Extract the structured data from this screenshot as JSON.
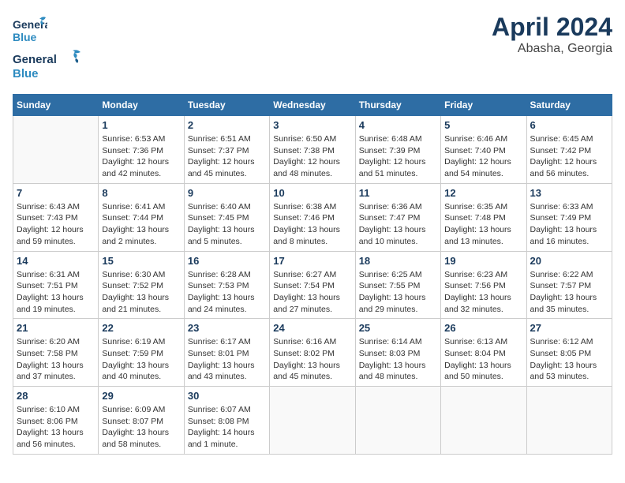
{
  "header": {
    "logo_line1": "General",
    "logo_line2": "Blue",
    "month_year": "April 2024",
    "location": "Abasha, Georgia"
  },
  "weekdays": [
    "Sunday",
    "Monday",
    "Tuesday",
    "Wednesday",
    "Thursday",
    "Friday",
    "Saturday"
  ],
  "weeks": [
    [
      {
        "day": "",
        "info": ""
      },
      {
        "day": "1",
        "info": "Sunrise: 6:53 AM\nSunset: 7:36 PM\nDaylight: 12 hours\nand 42 minutes."
      },
      {
        "day": "2",
        "info": "Sunrise: 6:51 AM\nSunset: 7:37 PM\nDaylight: 12 hours\nand 45 minutes."
      },
      {
        "day": "3",
        "info": "Sunrise: 6:50 AM\nSunset: 7:38 PM\nDaylight: 12 hours\nand 48 minutes."
      },
      {
        "day": "4",
        "info": "Sunrise: 6:48 AM\nSunset: 7:39 PM\nDaylight: 12 hours\nand 51 minutes."
      },
      {
        "day": "5",
        "info": "Sunrise: 6:46 AM\nSunset: 7:40 PM\nDaylight: 12 hours\nand 54 minutes."
      },
      {
        "day": "6",
        "info": "Sunrise: 6:45 AM\nSunset: 7:42 PM\nDaylight: 12 hours\nand 56 minutes."
      }
    ],
    [
      {
        "day": "7",
        "info": "Sunrise: 6:43 AM\nSunset: 7:43 PM\nDaylight: 12 hours\nand 59 minutes."
      },
      {
        "day": "8",
        "info": "Sunrise: 6:41 AM\nSunset: 7:44 PM\nDaylight: 13 hours\nand 2 minutes."
      },
      {
        "day": "9",
        "info": "Sunrise: 6:40 AM\nSunset: 7:45 PM\nDaylight: 13 hours\nand 5 minutes."
      },
      {
        "day": "10",
        "info": "Sunrise: 6:38 AM\nSunset: 7:46 PM\nDaylight: 13 hours\nand 8 minutes."
      },
      {
        "day": "11",
        "info": "Sunrise: 6:36 AM\nSunset: 7:47 PM\nDaylight: 13 hours\nand 10 minutes."
      },
      {
        "day": "12",
        "info": "Sunrise: 6:35 AM\nSunset: 7:48 PM\nDaylight: 13 hours\nand 13 minutes."
      },
      {
        "day": "13",
        "info": "Sunrise: 6:33 AM\nSunset: 7:49 PM\nDaylight: 13 hours\nand 16 minutes."
      }
    ],
    [
      {
        "day": "14",
        "info": "Sunrise: 6:31 AM\nSunset: 7:51 PM\nDaylight: 13 hours\nand 19 minutes."
      },
      {
        "day": "15",
        "info": "Sunrise: 6:30 AM\nSunset: 7:52 PM\nDaylight: 13 hours\nand 21 minutes."
      },
      {
        "day": "16",
        "info": "Sunrise: 6:28 AM\nSunset: 7:53 PM\nDaylight: 13 hours\nand 24 minutes."
      },
      {
        "day": "17",
        "info": "Sunrise: 6:27 AM\nSunset: 7:54 PM\nDaylight: 13 hours\nand 27 minutes."
      },
      {
        "day": "18",
        "info": "Sunrise: 6:25 AM\nSunset: 7:55 PM\nDaylight: 13 hours\nand 29 minutes."
      },
      {
        "day": "19",
        "info": "Sunrise: 6:23 AM\nSunset: 7:56 PM\nDaylight: 13 hours\nand 32 minutes."
      },
      {
        "day": "20",
        "info": "Sunrise: 6:22 AM\nSunset: 7:57 PM\nDaylight: 13 hours\nand 35 minutes."
      }
    ],
    [
      {
        "day": "21",
        "info": "Sunrise: 6:20 AM\nSunset: 7:58 PM\nDaylight: 13 hours\nand 37 minutes."
      },
      {
        "day": "22",
        "info": "Sunrise: 6:19 AM\nSunset: 7:59 PM\nDaylight: 13 hours\nand 40 minutes."
      },
      {
        "day": "23",
        "info": "Sunrise: 6:17 AM\nSunset: 8:01 PM\nDaylight: 13 hours\nand 43 minutes."
      },
      {
        "day": "24",
        "info": "Sunrise: 6:16 AM\nSunset: 8:02 PM\nDaylight: 13 hours\nand 45 minutes."
      },
      {
        "day": "25",
        "info": "Sunrise: 6:14 AM\nSunset: 8:03 PM\nDaylight: 13 hours\nand 48 minutes."
      },
      {
        "day": "26",
        "info": "Sunrise: 6:13 AM\nSunset: 8:04 PM\nDaylight: 13 hours\nand 50 minutes."
      },
      {
        "day": "27",
        "info": "Sunrise: 6:12 AM\nSunset: 8:05 PM\nDaylight: 13 hours\nand 53 minutes."
      }
    ],
    [
      {
        "day": "28",
        "info": "Sunrise: 6:10 AM\nSunset: 8:06 PM\nDaylight: 13 hours\nand 56 minutes."
      },
      {
        "day": "29",
        "info": "Sunrise: 6:09 AM\nSunset: 8:07 PM\nDaylight: 13 hours\nand 58 minutes."
      },
      {
        "day": "30",
        "info": "Sunrise: 6:07 AM\nSunset: 8:08 PM\nDaylight: 14 hours\nand 1 minute."
      },
      {
        "day": "",
        "info": ""
      },
      {
        "day": "",
        "info": ""
      },
      {
        "day": "",
        "info": ""
      },
      {
        "day": "",
        "info": ""
      }
    ]
  ]
}
